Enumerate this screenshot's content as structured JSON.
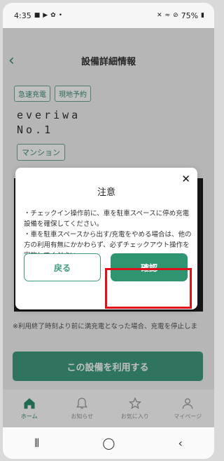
{
  "status_bar": {
    "time": "4:35",
    "battery": "75%"
  },
  "page": {
    "title": "設備詳細情報",
    "tags": [
      "急速充電",
      "現地予約"
    ],
    "station_name_line1": "everiwa",
    "station_name_line2": "No.1",
    "type_tag": "マンション",
    "note": "※利用終了時刻より前に満充電となった場合、充電を停止しま",
    "use_button": "この設備を利用する"
  },
  "tabs": [
    {
      "label": "ホーム",
      "icon": "home-icon"
    },
    {
      "label": "お知らせ",
      "icon": "bell-icon"
    },
    {
      "label": "お気に入り",
      "icon": "star-icon"
    },
    {
      "label": "マイページ",
      "icon": "person-icon"
    }
  ],
  "dialog": {
    "title": "注意",
    "line1": "・チェックイン操作前に、車を駐車スペースに停め充電設備を確保してください。",
    "line2": "・車を駐車スペースから出す/充電をやめる場合は、他の方の利用有無にかかわらず、必ずチェックアウト操作を実施してください。",
    "back_label": "戻る",
    "confirm_label": "確認"
  },
  "colors": {
    "accent": "#2f9571",
    "highlight": "#e0101a"
  }
}
